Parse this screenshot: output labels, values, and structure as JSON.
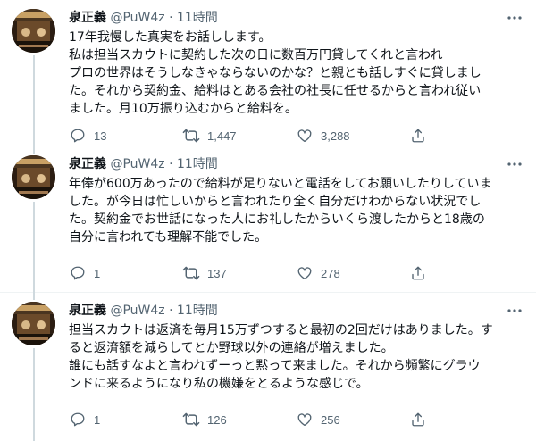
{
  "tweets": [
    {
      "name": "泉正義",
      "handle": "@PuW4z",
      "separator": "·",
      "time": "11時間",
      "lines": [
        "17年我慢した真実をお話しします。",
        "私は担当スカウトに契約した次の日に数百万円貸してくれと言われ",
        "プロの世界はそうしなきゃならないのかな？と親とも話しすぐに貸しまし",
        "た。それから契約金、給料はとある会社の社長に任せるからと言われ従い",
        "ました。月10万振り込むからと給料を。"
      ],
      "replies": "13",
      "retweets": "1,447",
      "likes": "3,288"
    },
    {
      "name": "泉正義",
      "handle": "@PuW4z",
      "separator": "·",
      "time": "11時間",
      "lines": [
        "年俸が600万あったので給料が足りないと電話をしてお願いしたりしていま",
        "した。が今日は忙しいからと言われたり全く自分だけわからない状況でし",
        "た。契約金でお世話になった人にお礼したからいくら渡したからと18歳の",
        "自分に言われても理解不能でした。"
      ],
      "replies": "1",
      "retweets": "137",
      "likes": "278"
    },
    {
      "name": "泉正義",
      "handle": "@PuW4z",
      "separator": "·",
      "time": "11時間",
      "lines": [
        "担当スカウトは返済を毎月15万ずつすると最初の2回だけはありました。す",
        "ると返済額を減らしてとか野球以外の連絡が増えました。",
        "誰にも話すなよと言われずーっと黙って来ました。それから頻繁にグラウ",
        "ンドに来るようになり私の機嫌をとるような感じで。"
      ],
      "replies": "1",
      "retweets": "126",
      "likes": "256"
    }
  ],
  "icons": {
    "more": "more-horizontal-icon",
    "reply": "reply-icon",
    "retweet": "retweet-icon",
    "like": "heart-icon",
    "share": "share-icon"
  },
  "colors": {
    "text": "#0f1419",
    "secondary": "#536471",
    "thread_line": "#cfd9de",
    "divider": "#eff3f4"
  }
}
